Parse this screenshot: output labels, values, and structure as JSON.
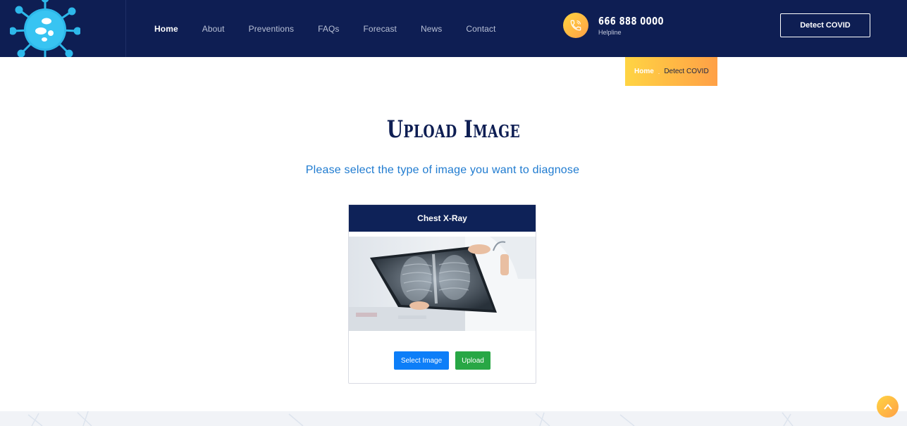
{
  "header": {
    "logo_icon": "virus-logo-icon",
    "nav": [
      {
        "label": "Home",
        "active": true
      },
      {
        "label": "About",
        "active": false
      },
      {
        "label": "Preventions",
        "active": false
      },
      {
        "label": "FAQs",
        "active": false
      },
      {
        "label": "Forecast",
        "active": false
      },
      {
        "label": "News",
        "active": false
      },
      {
        "label": "Contact",
        "active": false
      }
    ],
    "helpline": {
      "icon": "phone-icon",
      "number": "666 888 0000",
      "label": "Helpline"
    },
    "cta_label": "Detect COVID"
  },
  "breadcrumb": {
    "home": "Home",
    "separator": ".",
    "current": "Detect COVID"
  },
  "main": {
    "title": "Upload Image",
    "subtitle": "Please select the type of image you want to diagnose",
    "card": {
      "title": "Chest X-Ray",
      "image": "doctor-holding-chest-xray-photo",
      "select_label": "Select Image",
      "upload_label": "Upload"
    }
  },
  "scroll_top_icon": "arrow-up-icon",
  "colors": {
    "header_bg": "#0e1e53",
    "accent_gradient_start": "#ffd443",
    "accent_gradient_end": "#ffa046",
    "subtitle": "#1f7bd0",
    "select_button": "#0d7ef8",
    "upload_button": "#28a745"
  }
}
